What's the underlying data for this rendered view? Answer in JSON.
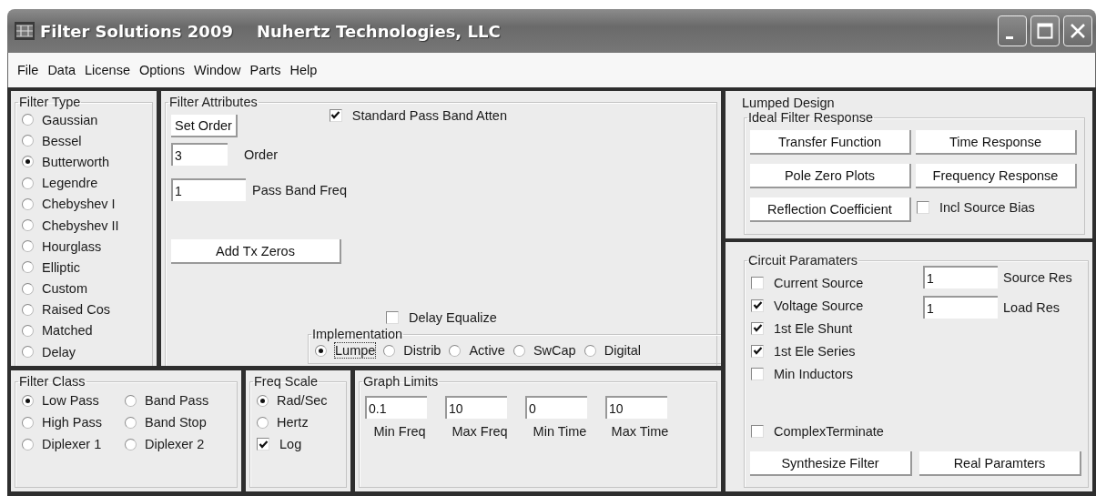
{
  "window": {
    "title": "Filter Solutions 2009",
    "subtitle": "Nuhertz Technologies, LLC"
  },
  "menu": [
    "File",
    "Data",
    "License",
    "Options",
    "Window",
    "Parts",
    "Help"
  ],
  "filter_type": {
    "label": "Filter Type",
    "options": [
      {
        "label": "Gaussian",
        "selected": false
      },
      {
        "label": "Bessel",
        "selected": false
      },
      {
        "label": "Butterworth",
        "selected": true
      },
      {
        "label": "Legendre",
        "selected": false
      },
      {
        "label": "Chebyshev I",
        "selected": false
      },
      {
        "label": "Chebyshev II",
        "selected": false
      },
      {
        "label": "Hourglass",
        "selected": false
      },
      {
        "label": "Elliptic",
        "selected": false
      },
      {
        "label": "Custom",
        "selected": false
      },
      {
        "label": "Raised Cos",
        "selected": false
      },
      {
        "label": "Matched",
        "selected": false
      },
      {
        "label": "Delay",
        "selected": false
      }
    ]
  },
  "filter_attributes": {
    "label": "Filter Attributes",
    "set_order_button": "Set Order",
    "standard_pass_band_atten": {
      "label": "Standard Pass Band Atten",
      "checked": true
    },
    "order": {
      "value": "3",
      "label": "Order"
    },
    "pass_band_freq": {
      "value": "1",
      "label": "Pass Band Freq"
    },
    "add_tx_zeros_button": "Add Tx Zeros",
    "delay_equalize": {
      "label": "Delay Equalize",
      "checked": false
    },
    "implementation": {
      "label": "Implementation",
      "options": [
        {
          "label": "Lumpe",
          "selected": true
        },
        {
          "label": "Distrib",
          "selected": false
        },
        {
          "label": "Active",
          "selected": false
        },
        {
          "label": "SwCap",
          "selected": false
        },
        {
          "label": "Digital",
          "selected": false
        }
      ]
    }
  },
  "filter_class": {
    "label": "Filter Class",
    "options": [
      {
        "label": "Low Pass",
        "selected": true
      },
      {
        "label": "Band Pass",
        "selected": false
      },
      {
        "label": "High Pass",
        "selected": false
      },
      {
        "label": "Band Stop",
        "selected": false
      },
      {
        "label": "Diplexer 1",
        "selected": false
      },
      {
        "label": "Diplexer 2",
        "selected": false
      }
    ]
  },
  "freq_scale": {
    "label": "Freq Scale",
    "options": [
      {
        "label": "Rad/Sec",
        "selected": true
      },
      {
        "label": "Hertz",
        "selected": false
      }
    ],
    "log": {
      "label": "Log",
      "checked": true
    }
  },
  "graph_limits": {
    "label": "Graph Limits",
    "fields": [
      {
        "value": "0.1",
        "label": "Min Freq"
      },
      {
        "value": "10",
        "label": "Max Freq"
      },
      {
        "value": "0",
        "label": "Min Time"
      },
      {
        "value": "10",
        "label": "Max Time"
      }
    ]
  },
  "lumped_design": {
    "label": "Lumped Design",
    "ideal_filter_response": {
      "label": "Ideal Filter Response",
      "buttons": [
        "Transfer Function",
        "Time Response",
        "Pole Zero Plots",
        "Frequency Response",
        "Reflection Coefficient"
      ],
      "incl_source_bias": {
        "label": "Incl Source Bias",
        "checked": false
      }
    },
    "circuit_parameters": {
      "label": "Circuit Paramaters",
      "checks": [
        {
          "label": "Current Source",
          "checked": false
        },
        {
          "label": "Voltage Source",
          "checked": true
        },
        {
          "label": "1st Ele Shunt",
          "checked": true
        },
        {
          "label": "1st Ele Series",
          "checked": true
        },
        {
          "label": "Min Inductors",
          "checked": false
        }
      ],
      "fields": [
        {
          "value": "1",
          "label": "Source Res"
        },
        {
          "value": "1",
          "label": "Load Res"
        }
      ],
      "complex_terminate": {
        "label": "ComplexTerminate",
        "checked": false
      },
      "buttons": [
        "Synthesize Filter",
        "Real Paramters"
      ]
    }
  }
}
